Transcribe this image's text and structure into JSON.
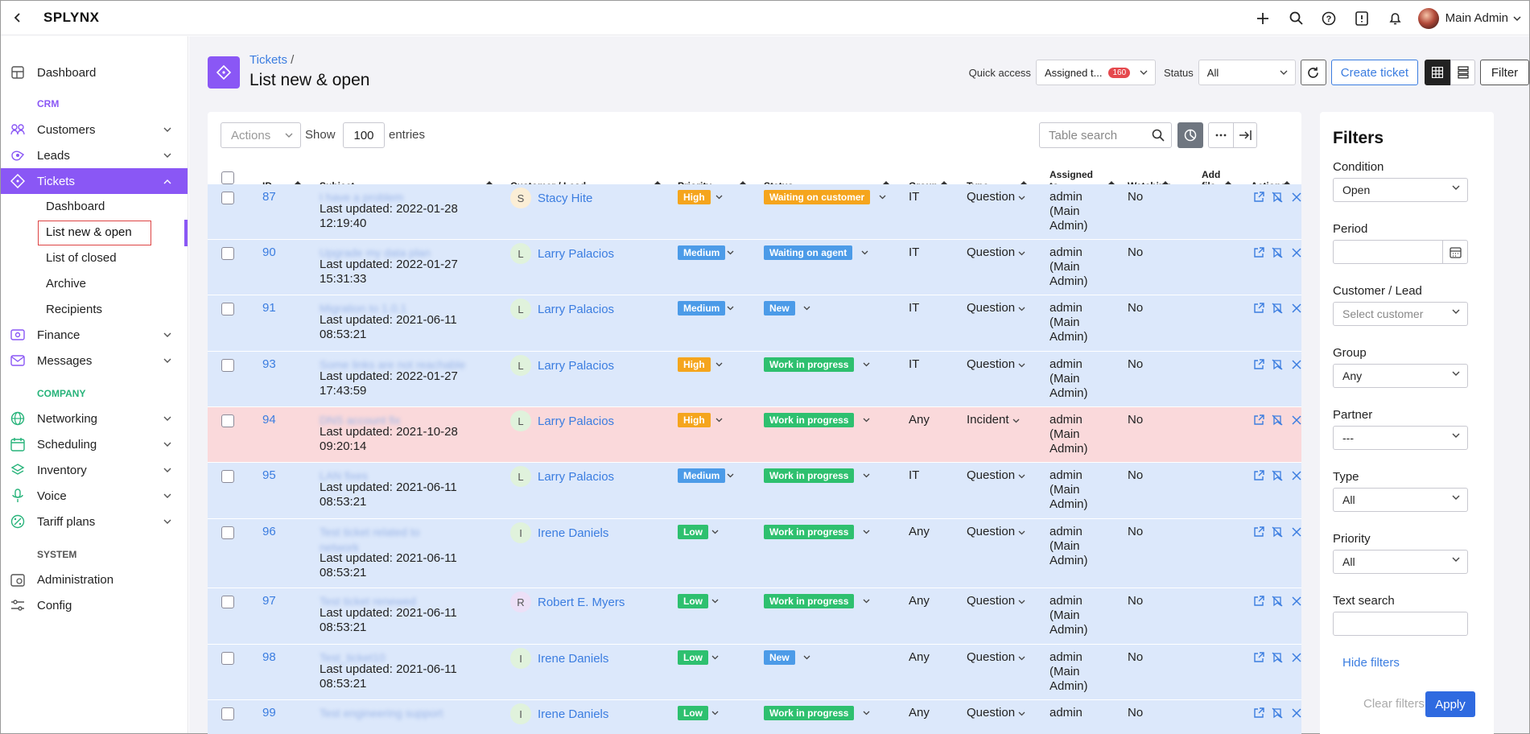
{
  "app": {
    "logo": "SPLYNX",
    "admin_name": "Main Admin"
  },
  "sidebar": {
    "dashboard": "Dashboard",
    "crm_label": "CRM",
    "customers": "Customers",
    "leads": "Leads",
    "tickets": "Tickets",
    "tickets_sub": [
      "Dashboard",
      "List new & open",
      "List of closed",
      "Archive",
      "Recipients"
    ],
    "finance": "Finance",
    "messages": "Messages",
    "company_label": "COMPANY",
    "networking": "Networking",
    "scheduling": "Scheduling",
    "inventory": "Inventory",
    "voice": "Voice",
    "tariff_plans": "Tariff plans",
    "system_label": "SYSTEM",
    "administration": "Administration",
    "config": "Config",
    "colors": {
      "accent": "#8a57f5",
      "crm": "#8a57f5",
      "company": "#27b37a",
      "system": "#555555"
    }
  },
  "header": {
    "breadcrumb": "Tickets",
    "breadcrumb_sep": "/",
    "title": "List new & open",
    "quick_access_label": "Quick access",
    "quick_access_value": "Assigned t...",
    "quick_access_count": "160",
    "status_label": "Status",
    "status_value": "All",
    "create_ticket": "Create ticket",
    "filter": "Filter"
  },
  "table": {
    "actions_placeholder": "Actions",
    "show_label": "Show",
    "entries_value": "100",
    "entries_label": "entries",
    "search_placeholder": "Table search",
    "columns": {
      "id": "ID",
      "subject": "Subject",
      "customer": "Customer / Lead",
      "priority": "Priority",
      "status": "Status",
      "group": "Group",
      "type": "Type",
      "assigned_1": "Assigned",
      "assigned_2": "to",
      "watching": "Watching",
      "addfile_1": "Add",
      "addfile_2": "file",
      "actions": "Actions"
    },
    "rows": [
      {
        "id": "87",
        "subject": "I have a problem",
        "lu_label": "Last updated:",
        "lu_date": "2022-01-28",
        "lu_time": "12:19:40",
        "initial": "S",
        "customer": "Stacy Hite",
        "priority": "High",
        "status": "Waiting on customer",
        "group": "IT",
        "type": "Question",
        "a1": "admin",
        "a2": "(Main",
        "a3": "Admin)",
        "watching": "No"
      },
      {
        "id": "90",
        "subject": "Upgrade my data plan",
        "lu_label": "Last updated:",
        "lu_date": "2022-01-27",
        "lu_time": "15:31:33",
        "initial": "L",
        "customer": "Larry Palacios",
        "priority": "Medium",
        "status": "Waiting on agent",
        "group": "IT",
        "type": "Question",
        "a1": "admin",
        "a2": "(Main",
        "a3": "Admin)",
        "watching": "No"
      },
      {
        "id": "91",
        "subject": "Migration to 1.0.1",
        "lu_label": "Last updated:",
        "lu_date": "2021-06-11",
        "lu_time": "08:53:21",
        "initial": "L",
        "customer": "Larry Palacios",
        "priority": "Medium",
        "status": "New",
        "group": "IT",
        "type": "Question",
        "a1": "admin",
        "a2": "(Main",
        "a3": "Admin)",
        "watching": "No"
      },
      {
        "id": "93",
        "subject": "Some links are not reachable",
        "lu_label": "Last updated:",
        "lu_date": "2022-01-27",
        "lu_time": "17:43:59",
        "initial": "L",
        "customer": "Larry Palacios",
        "priority": "High",
        "status": "Work in progress",
        "group": "IT",
        "type": "Question",
        "a1": "admin",
        "a2": "(Main",
        "a3": "Admin)",
        "watching": "No"
      },
      {
        "id": "94",
        "subject": "DNS account fix",
        "lu_label": "Last updated:",
        "lu_date": "2021-10-28",
        "lu_time": "09:20:14",
        "initial": "L",
        "customer": "Larry Palacios",
        "priority": "High",
        "status": "Work in progress",
        "group": "Any",
        "type": "Incident",
        "a1": "admin",
        "a2": "(Main",
        "a3": "Admin)",
        "watching": "No"
      },
      {
        "id": "95",
        "subject": "LAN fixes",
        "lu_label": "Last updated:",
        "lu_date": "2021-06-11",
        "lu_time": "08:53:21",
        "initial": "L",
        "customer": "Larry Palacios",
        "priority": "Medium",
        "status": "Work in progress",
        "group": "IT",
        "type": "Question",
        "a1": "admin",
        "a2": "(Main",
        "a3": "Admin)",
        "watching": "No"
      },
      {
        "id": "96",
        "subject": "Test ticket related to",
        "subject2": "network",
        "lu_label": "Last updated:",
        "lu_date": "2021-06-11",
        "lu_time": "08:53:21",
        "initial": "I",
        "customer": "Irene Daniels",
        "priority": "Low",
        "status": "Work in progress",
        "group": "Any",
        "type": "Question",
        "a1": "admin",
        "a2": "(Main",
        "a3": "Admin)",
        "watching": "No"
      },
      {
        "id": "97",
        "subject": "Test ticket renewed",
        "lu_label": "Last updated:",
        "lu_date": "2021-06-11",
        "lu_time": "08:53:21",
        "initial": "R",
        "customer": "Robert E. Myers",
        "priority": "Low",
        "status": "Work in progress",
        "group": "Any",
        "type": "Question",
        "a1": "admin",
        "a2": "(Main",
        "a3": "Admin)",
        "watching": "No"
      },
      {
        "id": "98",
        "subject": "Test_ticket10",
        "lu_label": "Last updated:",
        "lu_date": "2021-06-11",
        "lu_time": "08:53:21",
        "initial": "I",
        "customer": "Irene Daniels",
        "priority": "Low",
        "status": "New",
        "group": "Any",
        "type": "Question",
        "a1": "admin",
        "a2": "(Main",
        "a3": "Admin)",
        "watching": "No"
      },
      {
        "id": "99",
        "subject": "Test engineering support",
        "lu_label": "",
        "lu_date": "",
        "lu_time": "",
        "initial": "I",
        "customer": "Irene Daniels",
        "priority": "Low",
        "status": "Work in progress",
        "group": "Any",
        "type": "Question",
        "a1": "admin",
        "a2": "",
        "a3": "",
        "watching": "No"
      }
    ],
    "colors": {
      "high": "#f5a51d",
      "medium": "#4c9be8",
      "low": "#2ec06f",
      "waiting_customer": "#f5a51d",
      "waiting_agent": "#4c9be8",
      "new": "#4c9be8",
      "wip": "#2ec06f"
    }
  },
  "filters": {
    "title": "Filters",
    "condition_label": "Condition",
    "condition_value": "Open",
    "period_label": "Period",
    "customer_label": "Customer / Lead",
    "customer_placeholder": "Select customer",
    "group_label": "Group",
    "group_value": "Any",
    "partner_label": "Partner",
    "partner_value": "---",
    "type_label": "Type",
    "type_value": "All",
    "priority_label": "Priority",
    "priority_value": "All",
    "text_search_label": "Text search",
    "hide_filters": "Hide filters",
    "clear_filters": "Clear filters",
    "apply": "Apply"
  }
}
